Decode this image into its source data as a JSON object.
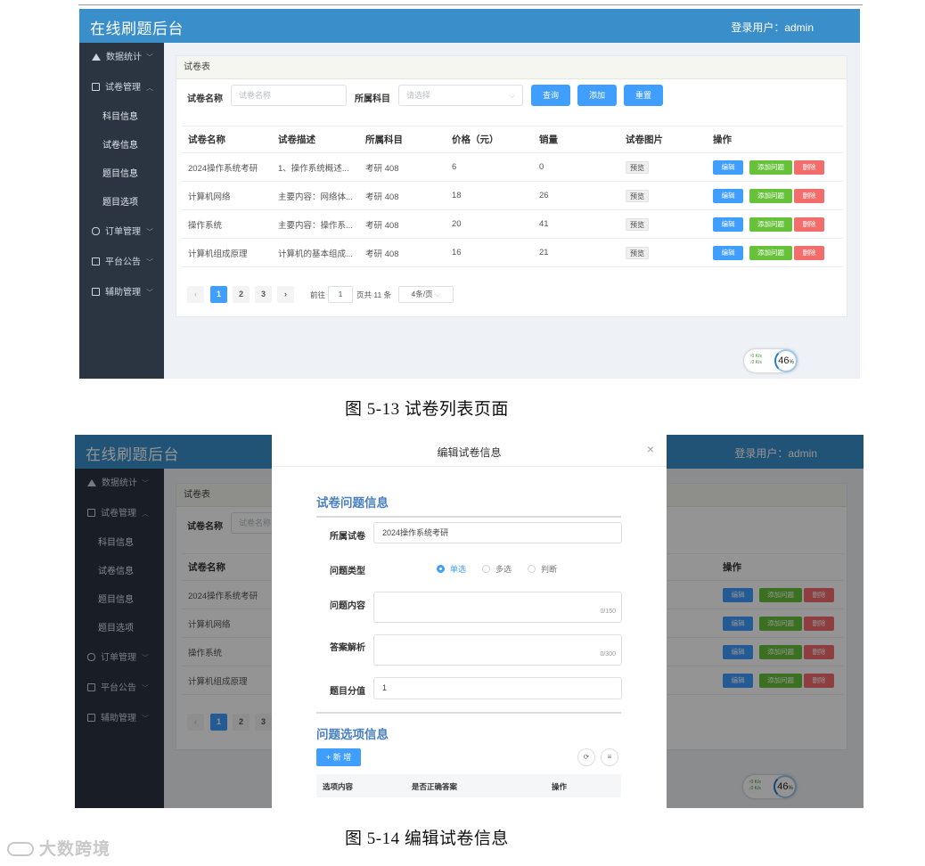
{
  "app": {
    "title": "在线刷题后台",
    "user": "登录用户：admin"
  },
  "sidebar": {
    "items": [
      {
        "label": "数据统计"
      },
      {
        "label": "试卷管理"
      },
      {
        "label": "订单管理"
      },
      {
        "label": "平台公告"
      },
      {
        "label": "辅助管理"
      }
    ],
    "sub_items": [
      {
        "label": "科目信息"
      },
      {
        "label": "试卷信息"
      },
      {
        "label": "题目信息"
      },
      {
        "label": "题目选项"
      }
    ]
  },
  "main": {
    "card_title": "试卷表",
    "search": {
      "name_label": "试卷名称",
      "name_placeholder": "试卷名称",
      "subject_label": "所属科目",
      "subject_placeholder": "请选择",
      "query_btn": "查询",
      "add_btn": "添加",
      "reset_btn": "重置"
    },
    "columns": [
      "试卷名称",
      "试卷描述",
      "所属科目",
      "价格（元）",
      "销量",
      "试卷图片",
      "操作"
    ],
    "rows": [
      {
        "name": "2024操作系统考研",
        "desc": "1、操作系统概述...",
        "subject": "考研 408",
        "price": "6",
        "sales": "0"
      },
      {
        "name": "计算机网络",
        "desc": "主要内容：网络体...",
        "subject": "考研 408",
        "price": "18",
        "sales": "26"
      },
      {
        "name": "操作系统",
        "desc": "主要内容：操作系...",
        "subject": "考研 408",
        "price": "20",
        "sales": "41"
      },
      {
        "name": "计算机组成原理",
        "desc": "计算机的基本组成...",
        "subject": "考研 408",
        "price": "16",
        "sales": "21"
      }
    ],
    "preview_label": "预览",
    "actions": {
      "edit": "编辑",
      "add_question": "添加问题",
      "delete": "删除"
    }
  },
  "pager": {
    "prev": "‹",
    "next": "›",
    "pages": [
      "1",
      "2",
      "3"
    ],
    "goto_label": "前往",
    "goto_value": "1",
    "total_text": "页共 11 条",
    "page_size": "4条/页"
  },
  "speed_widget": {
    "up": "↑0 K/s",
    "down": "↓0 K/s",
    "percent": "46",
    "unit": "%"
  },
  "captions": {
    "fig1": "图 5-13  试卷列表页面",
    "fig2": "图 5-14  编辑试卷信息"
  },
  "dialog": {
    "title": "编辑试卷信息",
    "close": "×",
    "section_question": "试卷问题信息",
    "paper_label": "所属试卷",
    "paper_value": "2024操作系统考研",
    "type_label": "问题类型",
    "type_options": [
      "单选",
      "多选",
      "判断"
    ],
    "type_selected": "单选",
    "content_label": "问题内容",
    "content_counter": "0/150",
    "analysis_label": "答案解析",
    "analysis_counter": "0/300",
    "score_label": "题目分值",
    "score_value": "1",
    "section_options": "问题选项信息",
    "new_btn": "+ 新 增",
    "opt_columns": [
      "选项内容",
      "是否正确答案",
      "操作"
    ]
  },
  "watermark": "大数跨境"
}
